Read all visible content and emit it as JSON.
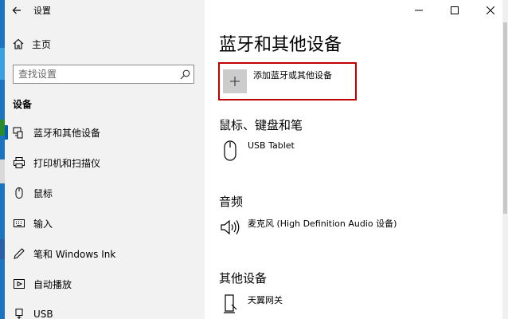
{
  "window": {
    "title": "设置",
    "controls": [
      "minimize",
      "maximize",
      "close"
    ]
  },
  "sidebar": {
    "home_label": "主页",
    "search_placeholder": "查找设置",
    "section_heading": "设备",
    "items": [
      {
        "label": "蓝牙和其他设备",
        "icon": "bluetooth-devices-icon",
        "active": true
      },
      {
        "label": "打印机和扫描仪",
        "icon": "printer-icon",
        "active": false
      },
      {
        "label": "鼠标",
        "icon": "mouse-icon",
        "active": false
      },
      {
        "label": "输入",
        "icon": "keyboard-icon",
        "active": false
      },
      {
        "label": "笔和 Windows Ink",
        "icon": "pen-icon",
        "active": false
      },
      {
        "label": "自动播放",
        "icon": "autoplay-icon",
        "active": false
      },
      {
        "label": "USB",
        "icon": "usb-icon",
        "active": false
      }
    ]
  },
  "main": {
    "title": "蓝牙和其他设备",
    "add_device_label": "添加蓝牙或其他设备",
    "groups": [
      {
        "heading": "鼠标、键盘和笔",
        "devices": [
          {
            "name": "USB Tablet",
            "icon": "mouse-icon"
          }
        ]
      },
      {
        "heading": "音频",
        "devices": [
          {
            "name": "麦克风 (High Definition Audio 设备)",
            "icon": "speaker-icon"
          }
        ]
      },
      {
        "heading": "其他设备",
        "devices": [
          {
            "name": "天翼网关",
            "icon": "network-device-icon"
          }
        ]
      }
    ]
  },
  "colors": {
    "sidebar_bg": "#f2f2f2",
    "accent": "#0063b1",
    "highlight_border": "#c00000"
  }
}
